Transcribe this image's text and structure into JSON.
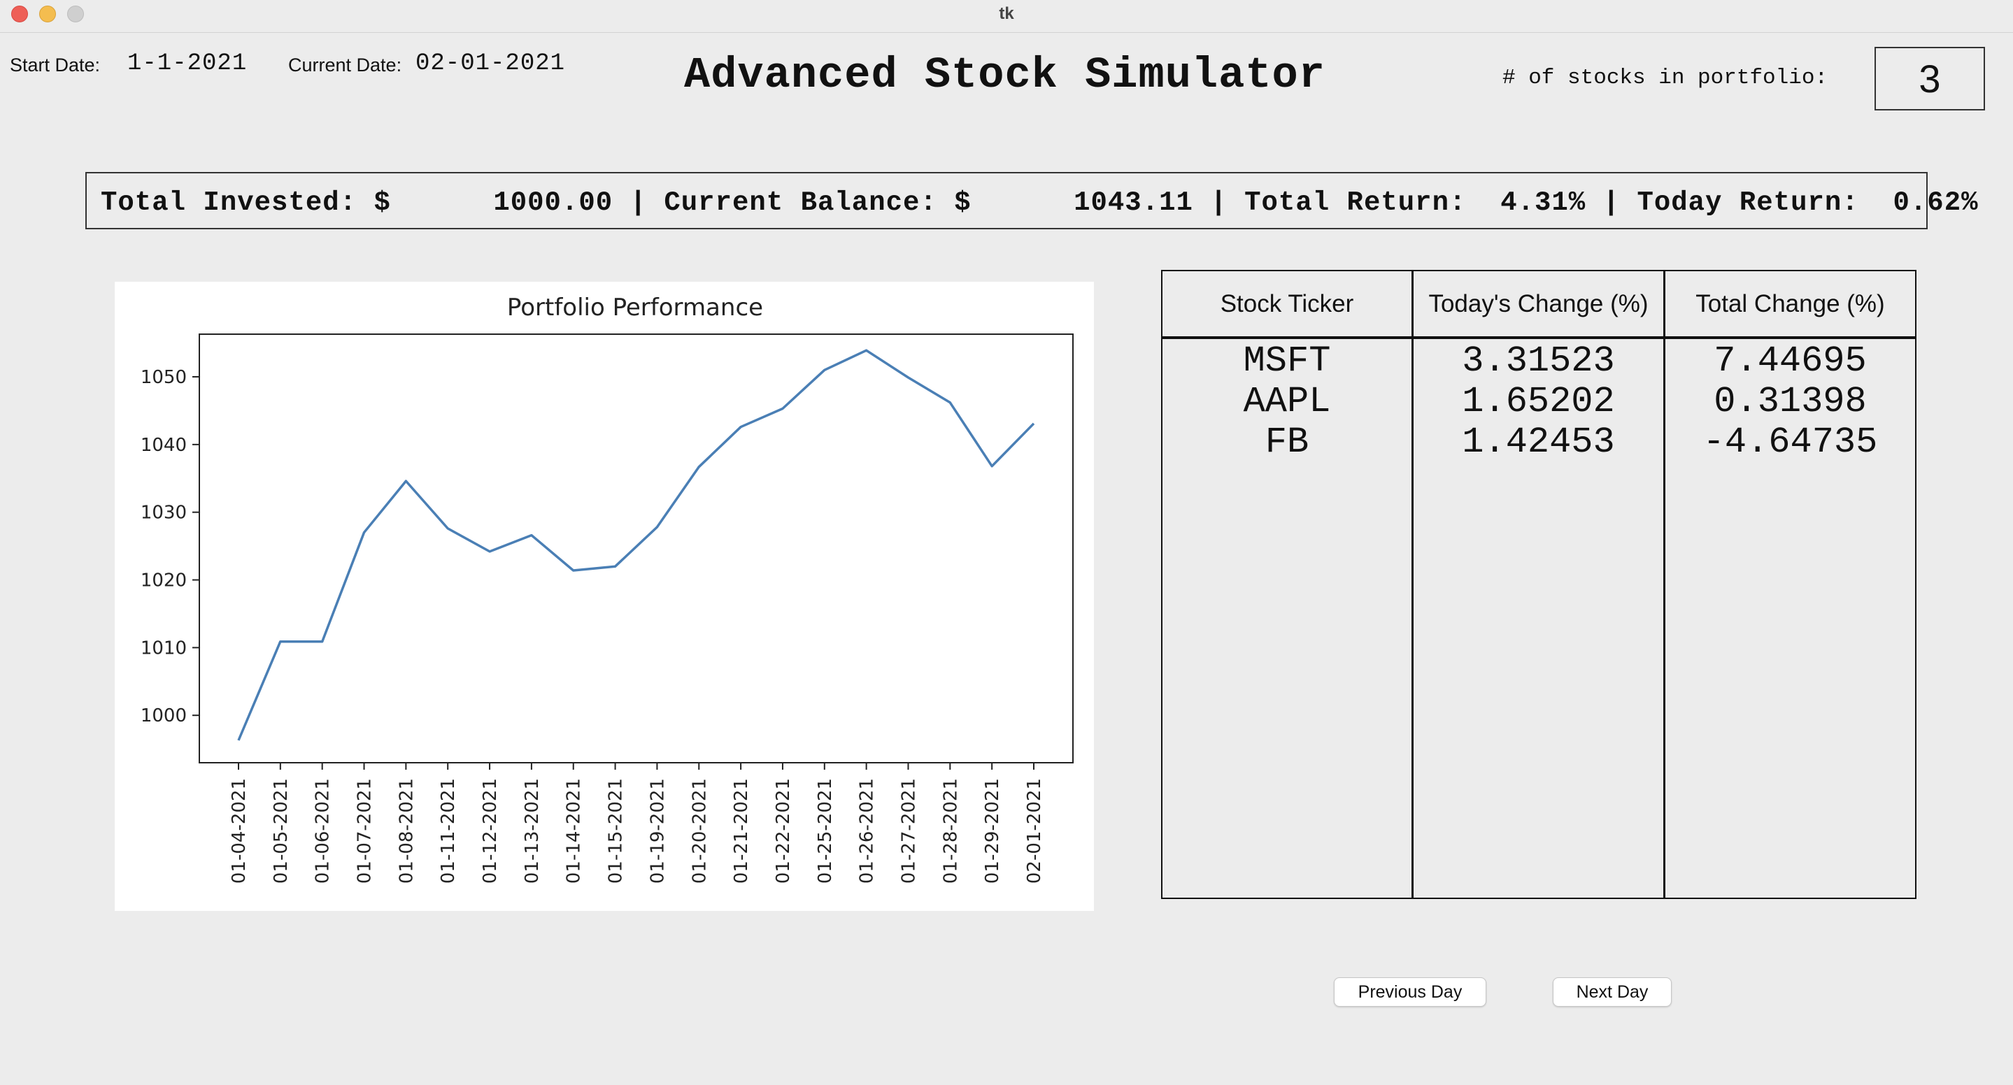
{
  "window": {
    "title": "tk"
  },
  "header": {
    "start_date_label": "Start Date:",
    "start_date_value": "1-1-2021",
    "current_date_label": "Current Date:",
    "current_date_value": "02-01-2021",
    "app_title": "Advanced Stock Simulator",
    "stock_count_label": "# of stocks in portfolio:",
    "stock_count_value": "3"
  },
  "stats": {
    "total_invested_label": "Total Invested: $",
    "total_invested_value": "1000.00",
    "current_balance_label": "Current Balance: $",
    "current_balance_value": "1043.11",
    "total_return_label": "Total Return:",
    "total_return_value": "4.31%",
    "today_return_label": "Today Return:",
    "today_return_value": "0.62%",
    "separator": "|"
  },
  "chart_data": {
    "type": "line",
    "title": "Portfolio Performance",
    "xlabel": "",
    "ylabel": "",
    "x": [
      "01-04-2021",
      "01-05-2021",
      "01-06-2021",
      "01-07-2021",
      "01-08-2021",
      "01-11-2021",
      "01-12-2021",
      "01-13-2021",
      "01-14-2021",
      "01-15-2021",
      "01-19-2021",
      "01-20-2021",
      "01-21-2021",
      "01-22-2021",
      "01-25-2021",
      "01-26-2021",
      "01-27-2021",
      "01-28-2021",
      "01-29-2021",
      "02-01-2021"
    ],
    "series": [
      {
        "name": "",
        "values": [
          996.3,
          1010.9,
          1010.9,
          1027.0,
          1034.6,
          1027.6,
          1024.2,
          1026.6,
          1021.4,
          1022.0,
          1027.8,
          1036.7,
          1042.6,
          1045.3,
          1051.0,
          1053.9,
          1049.9,
          1046.2,
          1036.8,
          1043.1
        ]
      }
    ],
    "ylim": [
      993.0,
      1056.3
    ],
    "yticks": [
      1000,
      1010,
      1020,
      1030,
      1040,
      1050
    ],
    "line_color": "#4a7fb5",
    "grid": false,
    "legend": "none"
  },
  "table": {
    "headers": [
      "Stock Ticker",
      "Today's Change (%)",
      "Total Change (%)"
    ],
    "rows": [
      [
        "MSFT",
        "3.31523",
        "7.44695"
      ],
      [
        "AAPL",
        "1.65202",
        "0.31398"
      ],
      [
        "FB",
        "1.42453",
        "-4.64735"
      ]
    ]
  },
  "buttons": {
    "previous_day": "Previous Day",
    "next_day": "Next Day"
  }
}
